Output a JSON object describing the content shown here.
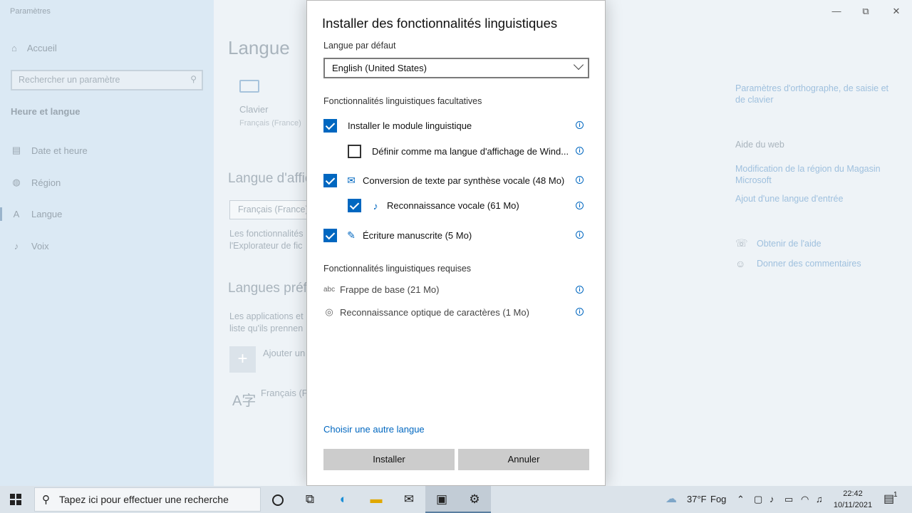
{
  "window": {
    "title": "Paramètres",
    "controls": {
      "minimize": "—",
      "maximize": "⧉",
      "close": "✕"
    }
  },
  "sidebar": {
    "home": {
      "label": "Accueil",
      "icon": "home-icon"
    },
    "search_placeholder": "Rechercher un paramètre",
    "section": "Heure et langue",
    "items": [
      {
        "label": "Date et heure",
        "icon": "calendar-clock-icon"
      },
      {
        "label": "Région",
        "icon": "globe-icon"
      },
      {
        "label": "Langue",
        "icon": "language-icon",
        "selected": true
      },
      {
        "label": "Voix",
        "icon": "microphone-icon"
      }
    ]
  },
  "main": {
    "title": "Langue",
    "keyboard_tile": {
      "label": "Clavier",
      "sub": "Français (France)"
    },
    "display_heading": "Langue d'affic",
    "display_select": "Français (France)",
    "display_desc": [
      "Les fonctionnalités",
      "l'Explorateur de fic"
    ],
    "preferred_heading": "Langues préfé",
    "preferred_desc": [
      "Les applications et",
      "liste qu'ils prennen"
    ],
    "add_label": "Ajouter un",
    "lang_item": "Français (Fr"
  },
  "right_panel": {
    "link_partial": "",
    "spelling_link": "Paramètres d'orthographe, de saisie et de clavier",
    "web_help_heading": "Aide du web",
    "web_links": [
      "Modification de la région du Magasin Microsoft",
      "Ajout d'une langue d'entrée"
    ],
    "help": {
      "label": "Obtenir de l'aide",
      "icon": "help-chat-icon"
    },
    "feedback": {
      "label": "Donner des commentaires",
      "icon": "feedback-icon"
    }
  },
  "dialog": {
    "title": "Installer des fonctionnalités linguistiques",
    "default_lang_label": "Langue par défaut",
    "default_lang_value": "English (United States)",
    "optional_heading": "Fonctionnalités linguistiques facultatives",
    "options": [
      {
        "label": "Installer le module linguistique",
        "checked": true
      },
      {
        "label": "Définir comme ma langue d'affichage de Wind...",
        "checked": false
      },
      {
        "label": "Conversion de texte par synthèse vocale (48 Mo)",
        "checked": true,
        "icon": "speech-icon"
      },
      {
        "label": "Reconnaissance vocale (61 Mo)",
        "checked": true,
        "icon": "microphone-icon"
      },
      {
        "label": "Écriture manuscrite (5 Mo)",
        "checked": true,
        "icon": "handwriting-icon"
      }
    ],
    "required_heading": "Fonctionnalités linguistiques requises",
    "required": [
      {
        "label": "Frappe de base (21 Mo)",
        "icon": "abc-icon"
      },
      {
        "label": "Reconnaissance optique de caractères (1 Mo)",
        "icon": "ocr-icon"
      }
    ],
    "choose_other": "Choisir une autre langue",
    "install_button": "Installer",
    "cancel_button": "Annuler"
  },
  "taskbar": {
    "search_placeholder": "Tapez ici pour effectuer une recherche",
    "weather": {
      "temp": "37°F",
      "condition": "Fog"
    },
    "time": "22:42",
    "date": "10/11/2021",
    "notifications": "1"
  }
}
